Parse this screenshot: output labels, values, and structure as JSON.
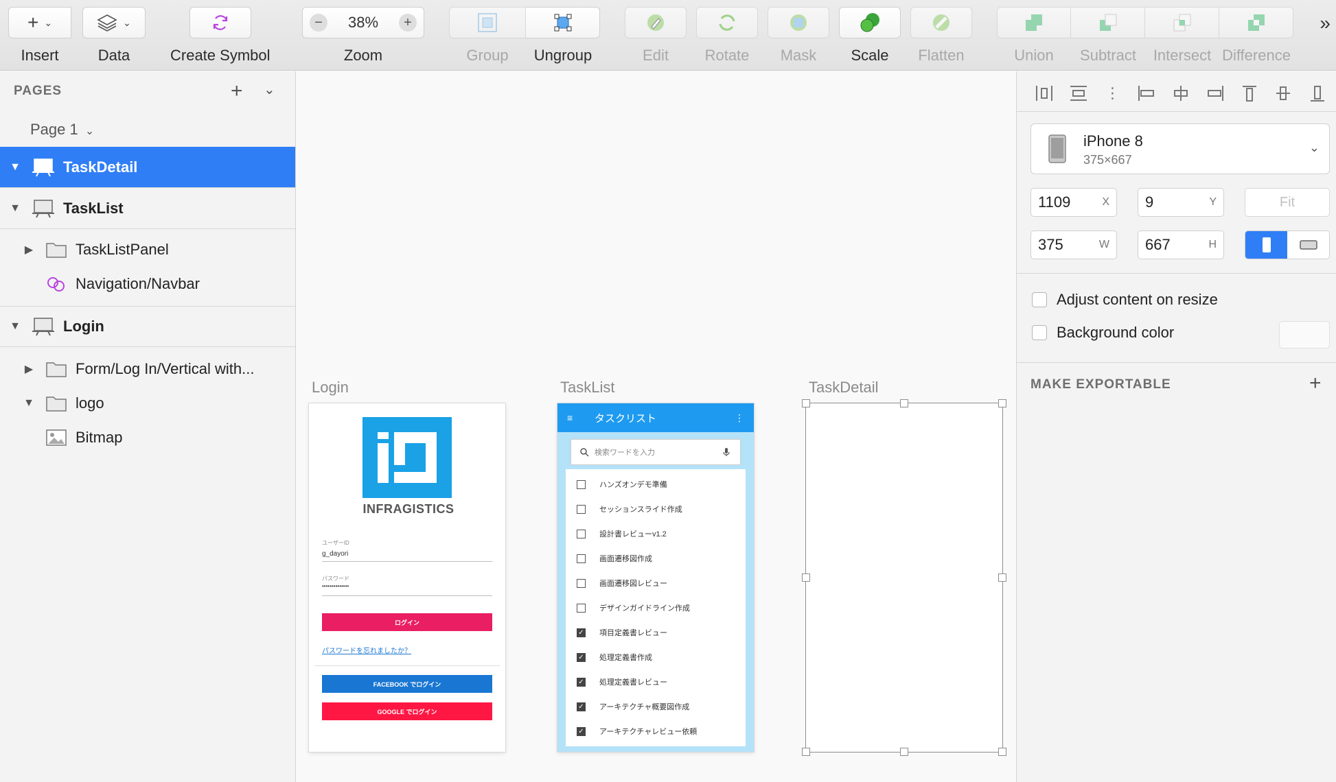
{
  "toolbar": {
    "insert": "Insert",
    "data": "Data",
    "create_symbol": "Create Symbol",
    "zoom": {
      "label": "Zoom",
      "value": "38%",
      "minus": "−",
      "plus": "+"
    },
    "group": "Group",
    "ungroup": "Ungroup",
    "edit": "Edit",
    "rotate": "Rotate",
    "mask": "Mask",
    "scale": "Scale",
    "flatten": "Flatten",
    "union": "Union",
    "subtract": "Subtract",
    "intersect": "Intersect",
    "difference": "Difference",
    "more": "»"
  },
  "left_panel": {
    "pages_header": "PAGES",
    "current_page": "Page 1",
    "layers": [
      {
        "label": "TaskDetail",
        "type": "artboard",
        "expanded": true,
        "selected": true
      },
      {
        "label": "TaskList",
        "type": "artboard",
        "expanded": true
      },
      {
        "label": "TaskListPanel",
        "type": "group"
      },
      {
        "label": "Navigation/Navbar",
        "type": "symbol"
      },
      {
        "label": "Login",
        "type": "artboard",
        "expanded": true
      },
      {
        "label": "Form/Log In/Vertical with...",
        "type": "group"
      },
      {
        "label": "logo",
        "type": "group",
        "expanded": true
      },
      {
        "label": "Bitmap",
        "type": "bitmap"
      }
    ]
  },
  "canvas": {
    "artboards": {
      "login": "Login",
      "tasklist": "TaskList",
      "taskdetail": "TaskDetail"
    },
    "login_mock": {
      "logo_text": "INFRAGISTICS",
      "user_id_label": "ユーザーID",
      "user_id_value": "g_dayori",
      "password_label": "パスワード",
      "password_value": "••••••••••••••",
      "login_button": "ログイン",
      "forgot_link": "パスワードを忘れましたか？",
      "facebook_button": "FACEBOOK でログイン",
      "google_button": "GOOGLE でログイン"
    },
    "tasklist_mock": {
      "title": "タスクリスト",
      "search_placeholder": "検索ワードを入力",
      "items": [
        {
          "label": "ハンズオンデモ準備",
          "checked": false
        },
        {
          "label": "セッションスライド作成",
          "checked": false
        },
        {
          "label": "設計書レビューv1.2",
          "checked": false
        },
        {
          "label": "画面遷移図作成",
          "checked": false
        },
        {
          "label": "画面遷移図レビュー",
          "checked": false
        },
        {
          "label": "デザインガイドライン作成",
          "checked": false
        },
        {
          "label": "項目定義書レビュー",
          "checked": true
        },
        {
          "label": "処理定義書作成",
          "checked": true
        },
        {
          "label": "処理定義書レビュー",
          "checked": true
        },
        {
          "label": "アーキテクチャ概要図作成",
          "checked": true
        },
        {
          "label": "アーキテクチャレビュー依頼",
          "checked": true
        }
      ]
    }
  },
  "inspector": {
    "device_name": "iPhone 8",
    "device_size": "375×667",
    "x": {
      "value": "1109",
      "axis": "X"
    },
    "y": {
      "value": "9",
      "axis": "Y"
    },
    "fit": "Fit",
    "w": {
      "value": "375",
      "axis": "W"
    },
    "h": {
      "value": "667",
      "axis": "H"
    },
    "adjust_content": "Adjust content on resize",
    "background_color": "Background color",
    "make_exportable": "MAKE EXPORTABLE"
  },
  "colors": {
    "selection_blue": "#2f7ef6",
    "infragistics_blue": "#1aa1e6",
    "login_pink": "#e91e63",
    "facebook_blue": "#1976d2",
    "google_red": "#ff1744",
    "tasklist_bar": "#1e9bf0"
  }
}
